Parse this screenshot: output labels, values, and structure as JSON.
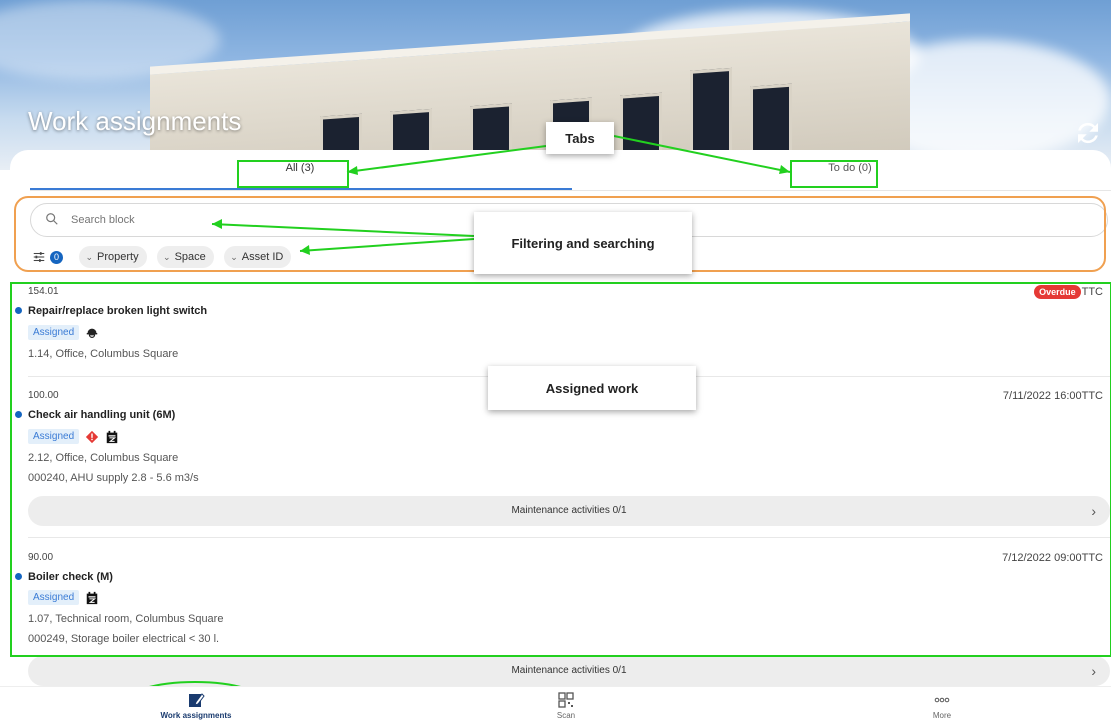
{
  "header": {
    "title": "Work assignments",
    "refresh_icon": "refresh-icon"
  },
  "tabs": [
    {
      "label": "All (3)",
      "active": true
    },
    {
      "label": "To do (0)",
      "active": false
    }
  ],
  "search": {
    "placeholder": "Search block",
    "icon": "search-icon"
  },
  "filters": {
    "filter_count": "0",
    "chips": [
      "Property",
      "Space",
      "Asset ID"
    ]
  },
  "items": [
    {
      "number": "154.01",
      "title": "Repair/replace broken light switch",
      "status": "Assigned",
      "badge": "Overdue",
      "date": "TTC",
      "location": "1.14, Office, Columbus Square",
      "icons": [
        "worker-icon"
      ]
    },
    {
      "number": "100.00",
      "title": "Check air handling unit (6M)",
      "status": "Assigned",
      "date": "7/11/2022 16:00TTC",
      "location": "2.12, Office, Columbus Square",
      "asset": "000240, AHU supply 2.8 - 5.6 m3/s",
      "maintenance": "Maintenance activities 0/1",
      "icons": [
        "warning-icon",
        "calendar-icon"
      ]
    },
    {
      "number": "90.00",
      "title": "Boiler check (M)",
      "status": "Assigned",
      "date": "7/12/2022 09:00TTC",
      "location": "1.07, Technical room, Columbus Square",
      "asset": "000249, Storage boiler electrical < 30 l.",
      "maintenance": "Maintenance activities 0/1",
      "icons": [
        "calendar-icon"
      ]
    }
  ],
  "annotations": {
    "tabs": "Tabs",
    "filtering": "Filtering and searching",
    "assigned": "Assigned work"
  },
  "bottom_nav": [
    {
      "label": "Work assignments",
      "icon": "edit-icon",
      "active": true
    },
    {
      "label": "Scan",
      "icon": "qr-icon"
    },
    {
      "label": "More",
      "icon": "more-icon"
    }
  ],
  "colors": {
    "accent": "#3a7bd5",
    "overdue": "#e53935",
    "annotation_green": "#22d01f",
    "annotation_orange": "#f0a050"
  }
}
